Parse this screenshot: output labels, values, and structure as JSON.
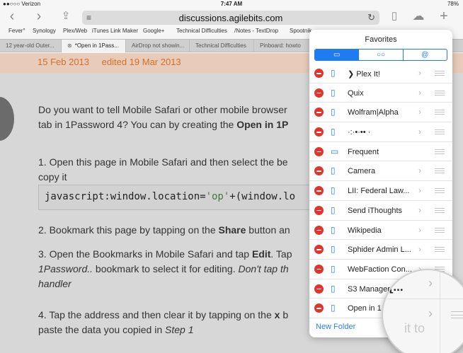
{
  "status": {
    "carrier": "●●○○○ Verizon",
    "time": "7:47 AM",
    "battery": "78%"
  },
  "nav": {
    "back": "‹",
    "forward": "›",
    "share": "⇪",
    "reader": "≡",
    "url": "discussions.agilebits.com",
    "reload": "↻",
    "bookmarks": "▯",
    "cloud": "☁",
    "new_tab": "+"
  },
  "favorites_bar": [
    "Fever°",
    "Synology",
    "Plex/Web",
    "iTunes Link Maker",
    "Google+",
    "Technical Difficulties",
    "/Notes - TextDrop",
    "Spootnik"
  ],
  "tabs": [
    {
      "label": "12 year-old Outer..."
    },
    {
      "label": "*Open in 1Pass...",
      "close": "⊗"
    },
    {
      "label": "AirDrop not showin..."
    },
    {
      "label": "Technical Difficulties"
    },
    {
      "label": "Pinboard: howto"
    }
  ],
  "page": {
    "date_posted": "15 Feb 2013",
    "date_edited": "edited 19 Mar 2013",
    "p1_line1": "Do you want to tell Mobile Safari or other mobile browser",
    "p1_line2_a": "tab in 1Password 4? You can by creating the ",
    "p1_line2_b": "Open in 1P",
    "step1_line1": "1. Open this page in Mobile Safari and then select the be",
    "step1_line2": "copy it",
    "code_a": "javascript:window.location=",
    "code_b": "'op'",
    "code_c": "+(window.lo",
    "step2_a": "2. Bookmark this page by tapping on the ",
    "step2_b": "Share",
    "step2_c": " button an",
    "step3_a": "3. Open the Bookmarks in Mobile Safari and tap ",
    "step3_b": "Edit",
    "step3_c": ". Tap",
    "step3_line2_a": "1Password..",
    "step3_line2_b": " bookmark to select it for editing. ",
    "step3_line2_c": "Don't tap th",
    "step3_line3": "handler",
    "step4_a": "4. Tap the address and then clear it by tapping on the ",
    "step4_b": "x",
    "step4_c": " b",
    "step4_line2_a": "paste the data you copied in ",
    "step4_line2_b": "Step 1"
  },
  "favorites": {
    "title": "Favorites",
    "segments": [
      "▭",
      "○○",
      "@"
    ],
    "items": [
      {
        "label": "❯ Plex It!"
      },
      {
        "label": "Quix"
      },
      {
        "label": "Wolfram|Alpha"
      },
      {
        "label": "·:·•·•• ·"
      },
      {
        "label": "Frequent"
      },
      {
        "label": "Camera"
      },
      {
        "label": "LII: Federal Law..."
      },
      {
        "label": "Send iThoughts"
      },
      {
        "label": "Wikipedia"
      },
      {
        "label": "Sphider Admin L..."
      },
      {
        "label": "WebFaction Con..."
      },
      {
        "label": "S3 Manager"
      },
      {
        "label": "Open in 1"
      }
    ],
    "new_folder": "New Folder"
  },
  "magnifier": {
    "text": "ı[...",
    "bg_text": "it to"
  }
}
